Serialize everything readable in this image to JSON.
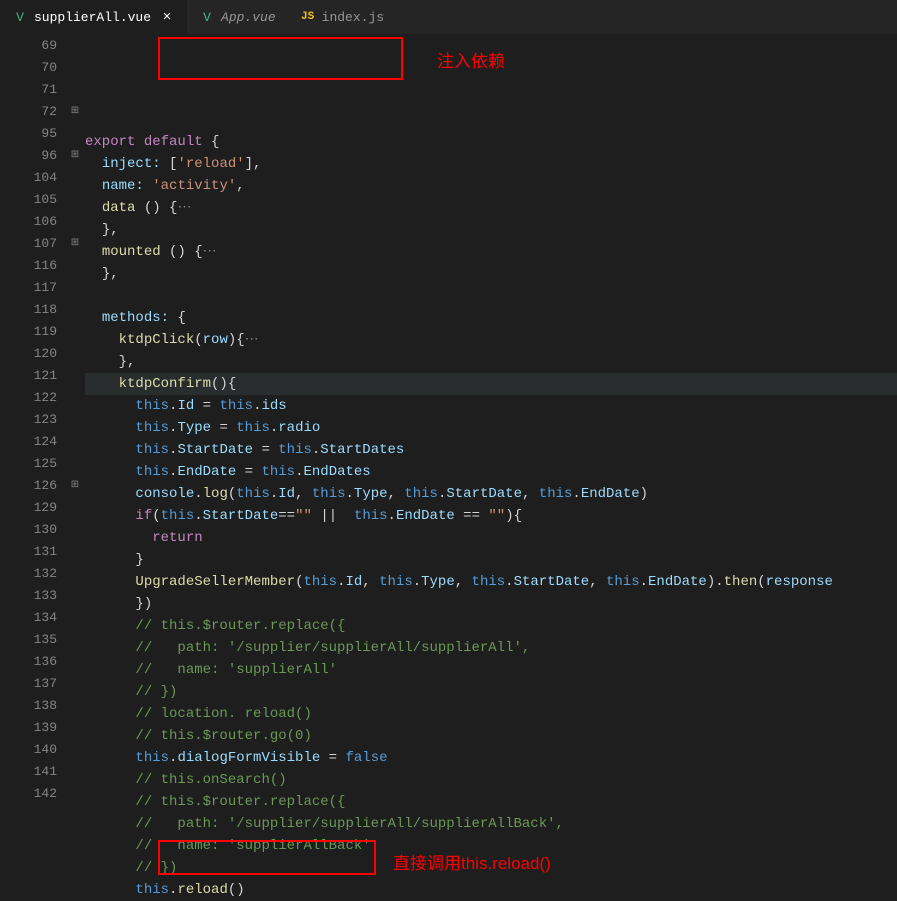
{
  "tabs": [
    {
      "name": "supplierAll.vue",
      "icon": "V",
      "active": true,
      "modified": false
    },
    {
      "name": "App.vue",
      "icon": "V",
      "active": false,
      "italic": true
    },
    {
      "name": "index.js",
      "icon": "JS",
      "active": false,
      "italic": false
    }
  ],
  "annotations": {
    "inject_label": "注入依赖",
    "reload_label": "直接调用this.reload()"
  },
  "code_lines": [
    {
      "num": "69",
      "fold": "",
      "html": "<span class='kw'>export</span> <span class='kw'>default</span> <span class='punct'>{</span>"
    },
    {
      "num": "70",
      "fold": "",
      "html": "  <span class='prop'>inject:</span> <span class='punct'>[</span><span class='str'>'reload'</span><span class='punct'>],</span>"
    },
    {
      "num": "71",
      "fold": "",
      "html": "  <span class='prop'>name:</span> <span class='str'>'activity'</span><span class='punct'>,</span>"
    },
    {
      "num": "72",
      "fold": "⊞",
      "html": "  <span class='func'>data</span> <span class='punct'>() {</span><span class='dots'>⋯</span>"
    },
    {
      "num": "95",
      "fold": "",
      "html": "  <span class='punct'>},</span>"
    },
    {
      "num": "96",
      "fold": "⊞",
      "html": "  <span class='func'>mounted</span> <span class='punct'>() {</span><span class='dots'>⋯</span>"
    },
    {
      "num": "104",
      "fold": "",
      "html": "  <span class='punct'>},</span>"
    },
    {
      "num": "105",
      "fold": "",
      "html": ""
    },
    {
      "num": "106",
      "fold": "",
      "html": "  <span class='prop'>methods:</span> <span class='punct'>{</span>"
    },
    {
      "num": "107",
      "fold": "⊞",
      "html": "    <span class='func'>ktdpClick</span><span class='punct'>(</span><span class='param'>row</span><span class='punct'>){</span><span class='dots'>⋯</span>"
    },
    {
      "num": "116",
      "fold": "",
      "html": "    <span class='punct'>},</span>"
    },
    {
      "num": "117",
      "fold": "",
      "html": "    <span class='func'>ktdpConfirm</span><span class='punct'>(){</span>",
      "hl": true
    },
    {
      "num": "118",
      "fold": "",
      "html": "      <span class='this'>this</span><span class='punct'>.</span><span class='prop'>Id</span> <span class='punct'>=</span> <span class='this'>this</span><span class='punct'>.</span><span class='prop'>ids</span>"
    },
    {
      "num": "119",
      "fold": "",
      "html": "      <span class='this'>this</span><span class='punct'>.</span><span class='prop'>Type</span> <span class='punct'>=</span> <span class='this'>this</span><span class='punct'>.</span><span class='prop'>radio</span>"
    },
    {
      "num": "120",
      "fold": "",
      "html": "      <span class='this'>this</span><span class='punct'>.</span><span class='prop'>StartDate</span> <span class='punct'>=</span> <span class='this'>this</span><span class='punct'>.</span><span class='prop'>StartDates</span>"
    },
    {
      "num": "121",
      "fold": "",
      "html": "      <span class='this'>this</span><span class='punct'>.</span><span class='prop'>EndDate</span> <span class='punct'>=</span> <span class='this'>this</span><span class='punct'>.</span><span class='prop'>EndDates</span>"
    },
    {
      "num": "122",
      "fold": "",
      "html": "      <span class='prop'>console</span><span class='punct'>.</span><span class='func'>log</span><span class='punct'>(</span><span class='this'>this</span><span class='punct'>.</span><span class='prop'>Id</span><span class='punct'>, </span><span class='this'>this</span><span class='punct'>.</span><span class='prop'>Type</span><span class='punct'>, </span><span class='this'>this</span><span class='punct'>.</span><span class='prop'>StartDate</span><span class='punct'>, </span><span class='this'>this</span><span class='punct'>.</span><span class='prop'>EndDate</span><span class='punct'>)</span>"
    },
    {
      "num": "123",
      "fold": "",
      "html": "      <span class='kw'>if</span><span class='punct'>(</span><span class='this'>this</span><span class='punct'>.</span><span class='prop'>StartDate</span><span class='punct'>==</span><span class='str'>\"\"</span> <span class='punct'>||</span>  <span class='this'>this</span><span class='punct'>.</span><span class='prop'>EndDate</span> <span class='punct'>==</span> <span class='str'>\"\"</span><span class='punct'>){</span>"
    },
    {
      "num": "124",
      "fold": "",
      "html": "        <span class='kw'>return</span>"
    },
    {
      "num": "125",
      "fold": "",
      "html": "      <span class='punct'>}</span>"
    },
    {
      "num": "126",
      "fold": "⊞",
      "html": "      <span class='func'>UpgradeSellerMember</span><span class='punct'>(</span><span class='this'>this</span><span class='punct'>.</span><span class='prop'>Id</span><span class='punct'>, </span><span class='this'>this</span><span class='punct'>.</span><span class='prop'>Type</span><span class='punct'>, </span><span class='this'>this</span><span class='punct'>.</span><span class='prop'>StartDate</span><span class='punct'>, </span><span class='this'>this</span><span class='punct'>.</span><span class='prop'>EndDate</span><span class='punct'>).</span><span class='func'>then</span><span class='punct'>(</span><span class='param'>response</span>"
    },
    {
      "num": "129",
      "fold": "",
      "html": "      <span class='punct'>})</span>"
    },
    {
      "num": "130",
      "fold": "",
      "html": "      <span class='comment'>// this.$router.replace({</span>"
    },
    {
      "num": "131",
      "fold": "",
      "html": "      <span class='comment'>//   path: '/supplier/supplierAll/supplierAll',</span>"
    },
    {
      "num": "132",
      "fold": "",
      "html": "      <span class='comment'>//   name: 'supplierAll'</span>"
    },
    {
      "num": "133",
      "fold": "",
      "html": "      <span class='comment'>// })</span>"
    },
    {
      "num": "134",
      "fold": "",
      "html": "      <span class='comment'>// location. reload()</span>"
    },
    {
      "num": "135",
      "fold": "",
      "html": "      <span class='comment'>// this.$router.go(0)</span>"
    },
    {
      "num": "136",
      "fold": "",
      "html": "      <span class='this'>this</span><span class='punct'>.</span><span class='prop'>dialogFormVisible</span> <span class='punct'>=</span> <span class='kw2'>false</span>"
    },
    {
      "num": "137",
      "fold": "",
      "html": "      <span class='comment'>// this.onSearch()</span>"
    },
    {
      "num": "138",
      "fold": "",
      "html": "      <span class='comment'>// this.$router.replace({</span>"
    },
    {
      "num": "139",
      "fold": "",
      "html": "      <span class='comment'>//   path: '/supplier/supplierAll/supplierAllBack',</span>"
    },
    {
      "num": "140",
      "fold": "",
      "html": "      <span class='comment'>//   name: 'supplierAllBack'</span>"
    },
    {
      "num": "141",
      "fold": "",
      "html": "      <span class='comment'>// })</span>"
    },
    {
      "num": "142",
      "fold": "",
      "html": "      <span class='this'>this</span><span class='punct'>.</span><span class='func'>reload</span><span class='punct'>()</span>"
    }
  ]
}
